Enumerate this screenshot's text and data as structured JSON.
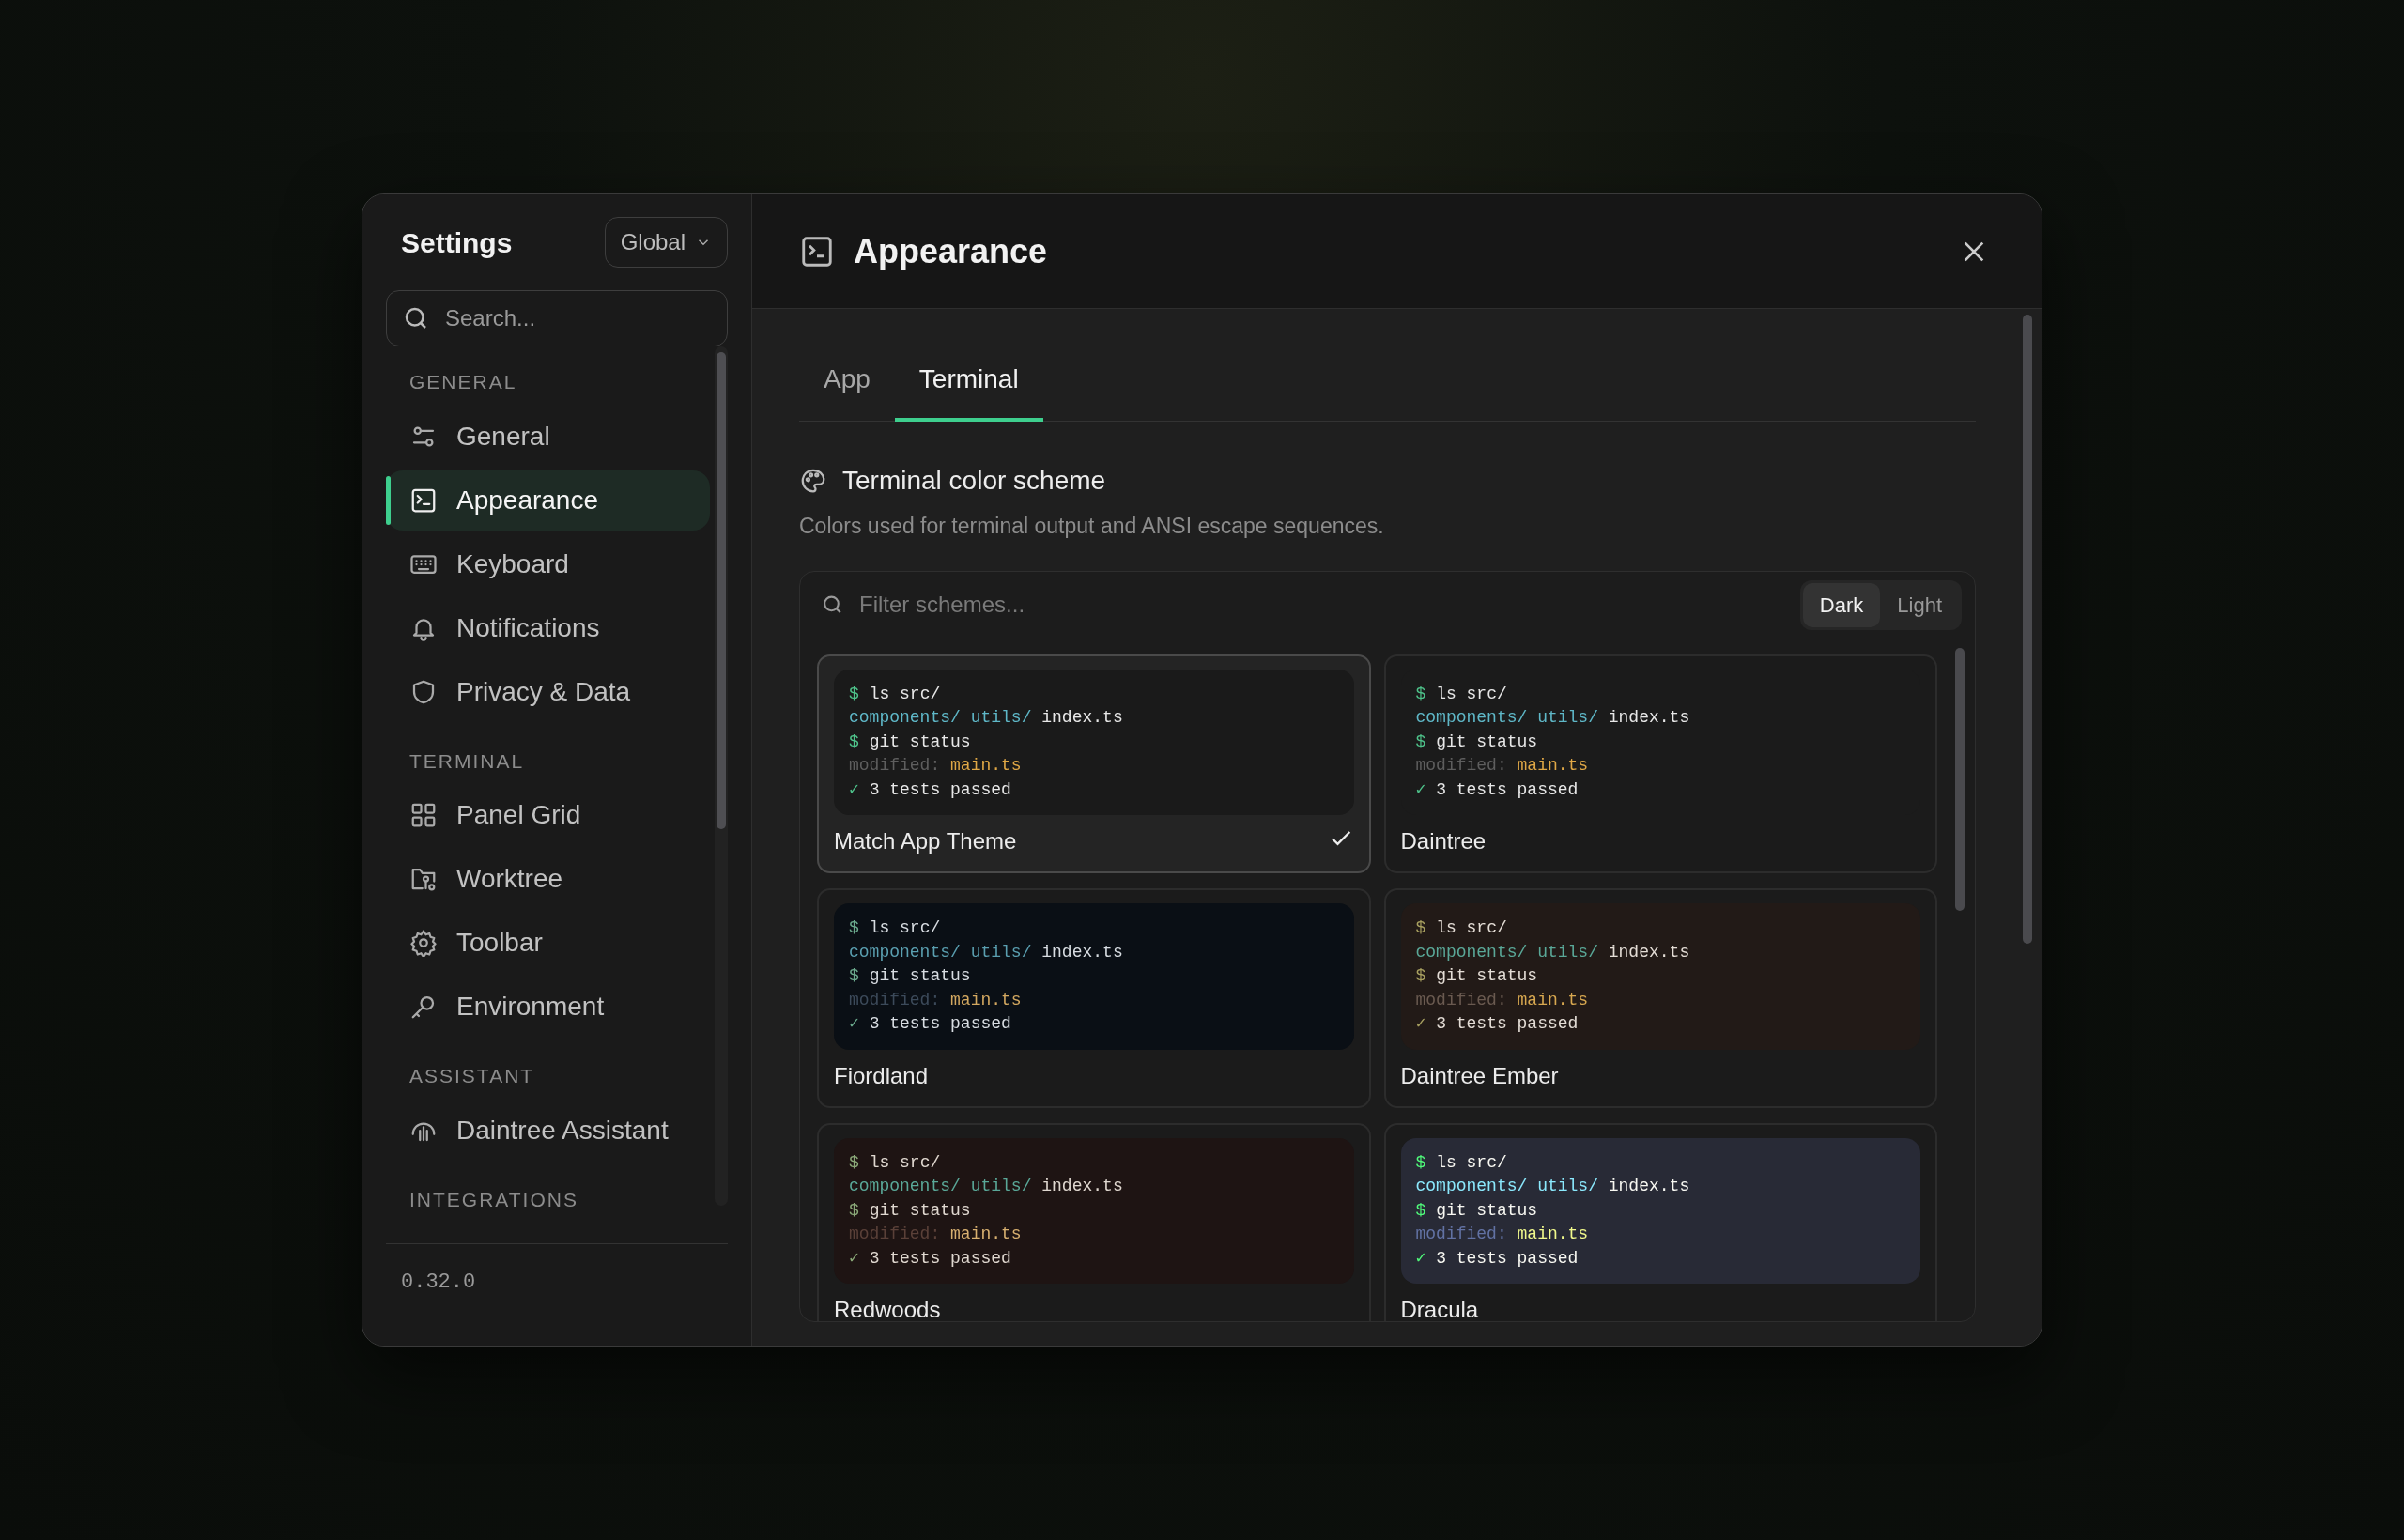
{
  "sidebar": {
    "title": "Settings",
    "scope_button": "Global",
    "search": {
      "placeholder": "Search..."
    },
    "sections": [
      {
        "label": "GENERAL",
        "items": [
          {
            "label": "General",
            "selected": false
          },
          {
            "label": "Appearance",
            "selected": true
          },
          {
            "label": "Keyboard",
            "selected": false
          },
          {
            "label": "Notifications",
            "selected": false
          },
          {
            "label": "Privacy & Data",
            "selected": false
          }
        ]
      },
      {
        "label": "TERMINAL",
        "items": [
          {
            "label": "Panel Grid",
            "selected": false
          },
          {
            "label": "Worktree",
            "selected": false
          },
          {
            "label": "Toolbar",
            "selected": false
          },
          {
            "label": "Environment",
            "selected": false
          }
        ]
      },
      {
        "label": "ASSISTANT",
        "items": [
          {
            "label": "Daintree Assistant",
            "selected": false
          }
        ]
      },
      {
        "label": "INTEGRATIONS"
      }
    ],
    "version": "0.32.0"
  },
  "header": {
    "title": "Appearance"
  },
  "tabs": [
    {
      "label": "App",
      "selected": false
    },
    {
      "label": "Terminal",
      "selected": true
    }
  ],
  "section": {
    "title": "Terminal color scheme",
    "description": "Colors used for terminal output and ANSI escape sequences."
  },
  "scheme_filter": {
    "placeholder": "Filter schemes...",
    "modes": [
      {
        "label": "Dark",
        "selected": true
      },
      {
        "label": "Light",
        "selected": false
      }
    ]
  },
  "schemes": [
    {
      "name": "Match App Theme",
      "selected": true,
      "color": "#1a1a1a",
      "preview": [
        [
          {
            "text": "$",
            "color": "#4ec28a"
          },
          {
            "text": "ls src/",
            "color": "#e8e8e8"
          }
        ],
        [
          {
            "text": "components/",
            "color": "#5fb8c8"
          },
          {
            "text": "utils/",
            "color": "#5fb8c8"
          },
          {
            "text": "index.ts",
            "color": "#e8e8e8"
          }
        ],
        [
          {
            "text": "$",
            "color": "#4ec28a"
          },
          {
            "text": "git status",
            "color": "#e8e8e8"
          }
        ],
        [
          {
            "text": "modified:",
            "color": "#5e5e5e"
          },
          {
            "text": "main.ts",
            "color": "#e0a846"
          }
        ],
        [
          {
            "text": "✓",
            "color": "#4ec28a"
          },
          {
            "text": "3 tests passed",
            "color": "#e8e8e8"
          }
        ]
      ]
    },
    {
      "name": "Daintree",
      "selected": false,
      "color": "#1b1b1b",
      "preview": [
        [
          {
            "text": "$",
            "color": "#4ec28a"
          },
          {
            "text": "ls src/",
            "color": "#e8e8e8"
          }
        ],
        [
          {
            "text": "components/",
            "color": "#5fb8c8"
          },
          {
            "text": "utils/",
            "color": "#5fb8c8"
          },
          {
            "text": "index.ts",
            "color": "#e8e8e8"
          }
        ],
        [
          {
            "text": "$",
            "color": "#4ec28a"
          },
          {
            "text": "git status",
            "color": "#e8e8e8"
          }
        ],
        [
          {
            "text": "modified:",
            "color": "#5e5e5e"
          },
          {
            "text": "main.ts",
            "color": "#e0a846"
          }
        ],
        [
          {
            "text": "✓",
            "color": "#4ec28a"
          },
          {
            "text": "3 tests passed",
            "color": "#e8e8e8"
          }
        ]
      ]
    },
    {
      "name": "Fiordland",
      "selected": false,
      "color": "#0a0f15",
      "preview": [
        [
          {
            "text": "$",
            "color": "#6aa88c"
          },
          {
            "text": "ls src/",
            "color": "#d8dde2"
          }
        ],
        [
          {
            "text": "components/",
            "color": "#5a9fb0"
          },
          {
            "text": "utils/",
            "color": "#5a9fb0"
          },
          {
            "text": "index.ts",
            "color": "#d8dde2"
          }
        ],
        [
          {
            "text": "$",
            "color": "#6aa88c"
          },
          {
            "text": "git status",
            "color": "#d8dde2"
          }
        ],
        [
          {
            "text": "modified:",
            "color": "#3c4a5a"
          },
          {
            "text": "main.ts",
            "color": "#d3a860"
          }
        ],
        [
          {
            "text": "✓",
            "color": "#6aa88c"
          },
          {
            "text": "3 tests passed",
            "color": "#d8dde2"
          }
        ]
      ]
    },
    {
      "name": "Daintree Ember",
      "selected": false,
      "color": "#221a17",
      "preview": [
        [
          {
            "text": "$",
            "color": "#a8a060"
          },
          {
            "text": "ls src/",
            "color": "#e4ddd6"
          }
        ],
        [
          {
            "text": "components/",
            "color": "#5aa898"
          },
          {
            "text": "utils/",
            "color": "#5aa898"
          },
          {
            "text": "index.ts",
            "color": "#e4ddd6"
          }
        ],
        [
          {
            "text": "$",
            "color": "#a8a060"
          },
          {
            "text": "git status",
            "color": "#e4ddd6"
          }
        ],
        [
          {
            "text": "modified:",
            "color": "#6a5a50"
          },
          {
            "text": "main.ts",
            "color": "#d8a850"
          }
        ],
        [
          {
            "text": "✓",
            "color": "#a8a060"
          },
          {
            "text": "3 tests passed",
            "color": "#e4ddd6"
          }
        ]
      ]
    },
    {
      "name": "Redwoods",
      "selected": false,
      "color": "#1e1413",
      "preview": [
        [
          {
            "text": "$",
            "color": "#8aa878"
          },
          {
            "text": "ls src/",
            "color": "#e0d8d0"
          }
        ],
        [
          {
            "text": "components/",
            "color": "#5aa898"
          },
          {
            "text": "utils/",
            "color": "#5aa898"
          },
          {
            "text": "index.ts",
            "color": "#e0d8d0"
          }
        ],
        [
          {
            "text": "$",
            "color": "#8aa878"
          },
          {
            "text": "git status",
            "color": "#e0d8d0"
          }
        ],
        [
          {
            "text": "modified:",
            "color": "#5a4038"
          },
          {
            "text": "main.ts",
            "color": "#d8b070"
          }
        ],
        [
          {
            "text": "✓",
            "color": "#8aa878"
          },
          {
            "text": "3 tests passed",
            "color": "#e0d8d0"
          }
        ]
      ]
    },
    {
      "name": "Dracula",
      "selected": false,
      "color": "#282a36",
      "preview": [
        [
          {
            "text": "$",
            "color": "#50fa7b"
          },
          {
            "text": "ls src/",
            "color": "#f8f8f2"
          }
        ],
        [
          {
            "text": "components/",
            "color": "#8be9fd"
          },
          {
            "text": "utils/",
            "color": "#8be9fd"
          },
          {
            "text": "index.ts",
            "color": "#f8f8f2"
          }
        ],
        [
          {
            "text": "$",
            "color": "#50fa7b"
          },
          {
            "text": "git status",
            "color": "#f8f8f2"
          }
        ],
        [
          {
            "text": "modified:",
            "color": "#6272a4"
          },
          {
            "text": "main.ts",
            "color": "#f1fa8c"
          }
        ],
        [
          {
            "text": "✓",
            "color": "#50fa7b"
          },
          {
            "text": "3 tests passed",
            "color": "#f8f8f2"
          }
        ]
      ]
    }
  ]
}
